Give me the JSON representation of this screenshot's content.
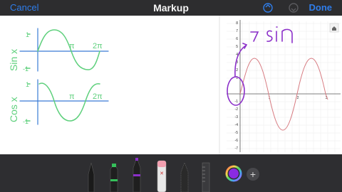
{
  "navbar": {
    "cancel_label": "Cancel",
    "title": "Markup",
    "done_label": "Done"
  },
  "annotation_left": {
    "sin_label": "Sin x",
    "cos_label": "Cos x",
    "tick_top": "1",
    "tick_bottom": "-1",
    "pi_label": "π",
    "two_pi_label": "2π"
  },
  "graph_panel": {
    "y_ticks": [
      "8",
      "7",
      "6",
      "5",
      "4",
      "3",
      "2",
      "1",
      "-1",
      "-2",
      "-3",
      "-4",
      "-5",
      "-6",
      "-7",
      "-8"
    ],
    "x_ticks": [
      "1",
      "2",
      "3"
    ],
    "handwritten_label": "-2 sin",
    "home_icon": "house-icon"
  },
  "toolbar": {
    "tools": [
      "pen-icon",
      "marker-icon",
      "pencil-icon",
      "eraser-icon",
      "lasso-icon",
      "ruler-icon"
    ],
    "color_swatch": "#8a2be2",
    "add_label": "+"
  },
  "colors": {
    "ink_green": "#5fd07d",
    "ink_purple": "#8b2fc9",
    "axis_blue": "#3a7bd5",
    "curve_red": "#d77a80"
  }
}
